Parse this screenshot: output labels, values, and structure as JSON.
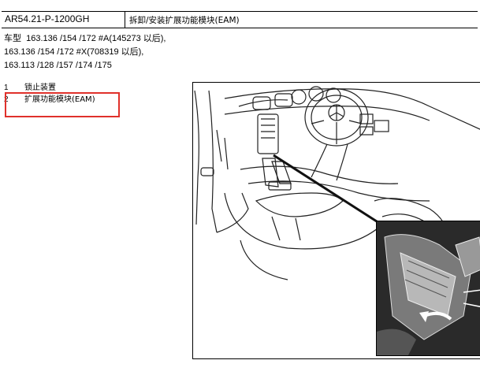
{
  "header": {
    "doc_code": "AR54.21-P-1200GH",
    "title": "拆卸/安装扩展功能模块(EAM)"
  },
  "models": {
    "label": "车型",
    "line1": "163.136 /154 /172 #A(145273 以后),",
    "line2": "163.136 /154 /172 #X(708319 以后),",
    "line3": "163.113 /128 /157 /174 /175"
  },
  "legend": [
    {
      "num": "1",
      "text": "锁止装置"
    },
    {
      "num": "2",
      "text": "扩展功能模块(EAM)"
    }
  ],
  "colors": {
    "highlight": "#e0312b"
  }
}
